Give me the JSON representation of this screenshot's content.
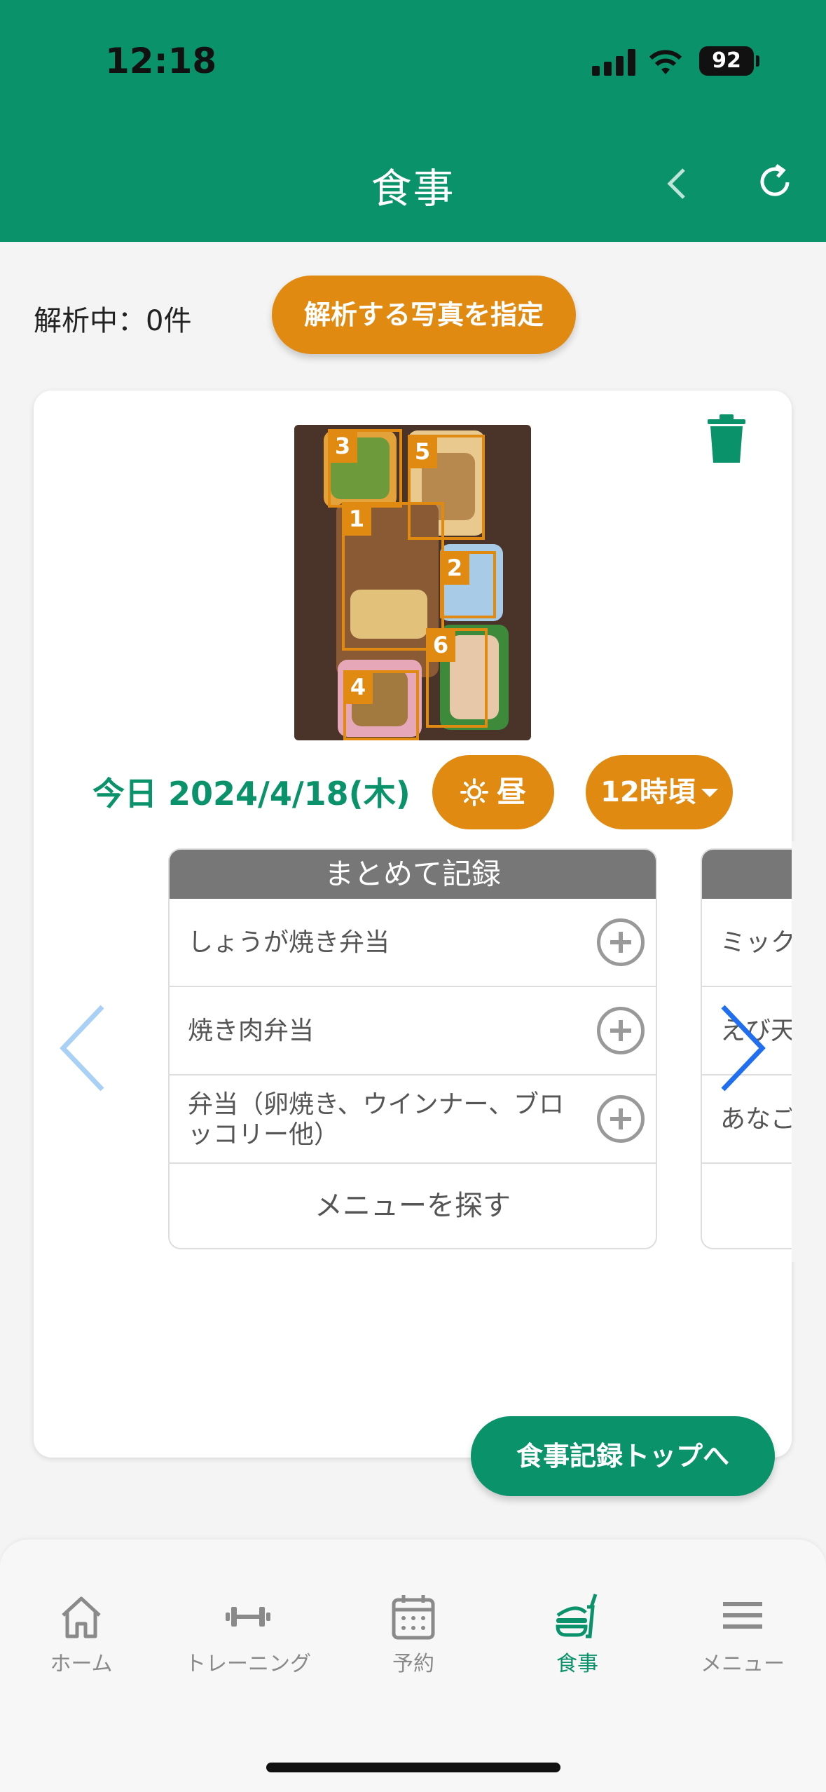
{
  "status_bar": {
    "time": "12:18",
    "battery": "92"
  },
  "header": {
    "title": "食事",
    "back_icon": "chevron-left-icon",
    "refresh_icon": "refresh-icon"
  },
  "analysis": {
    "count_text": "解析中：0件",
    "pick_photo_label": "解析する写真を指定"
  },
  "photo": {
    "box_labels": [
      "1",
      "2",
      "3",
      "4",
      "5",
      "6"
    ]
  },
  "meal_info": {
    "date": "今日 2024/4/18(木)",
    "meal_label": "昼",
    "meal_icon": "sun-icon",
    "time_label": "12時頃"
  },
  "suggestions": {
    "header": "まとめて記録",
    "items": [
      {
        "label": "しょうが焼き弁当"
      },
      {
        "label": "焼き肉弁当"
      },
      {
        "label": "弁当（卵焼き、ウインナー、ブロッコリー他）"
      }
    ],
    "search_label": "メニューを探す"
  },
  "next_panel": {
    "items": [
      "ミック",
      "えび天",
      "あなご"
    ]
  },
  "to_top_label": "食事記録トップへ",
  "colors": {
    "primary": "#0a926b",
    "accent": "#e08a12"
  },
  "tabbar": {
    "tabs": [
      {
        "label": "ホーム",
        "icon": "home-icon"
      },
      {
        "label": "トレーニング",
        "icon": "dumbbell-icon"
      },
      {
        "label": "予約",
        "icon": "calendar-icon"
      },
      {
        "label": "食事",
        "icon": "meal-icon",
        "active": true
      },
      {
        "label": "メニュー",
        "icon": "hamburger-menu-icon"
      }
    ]
  }
}
